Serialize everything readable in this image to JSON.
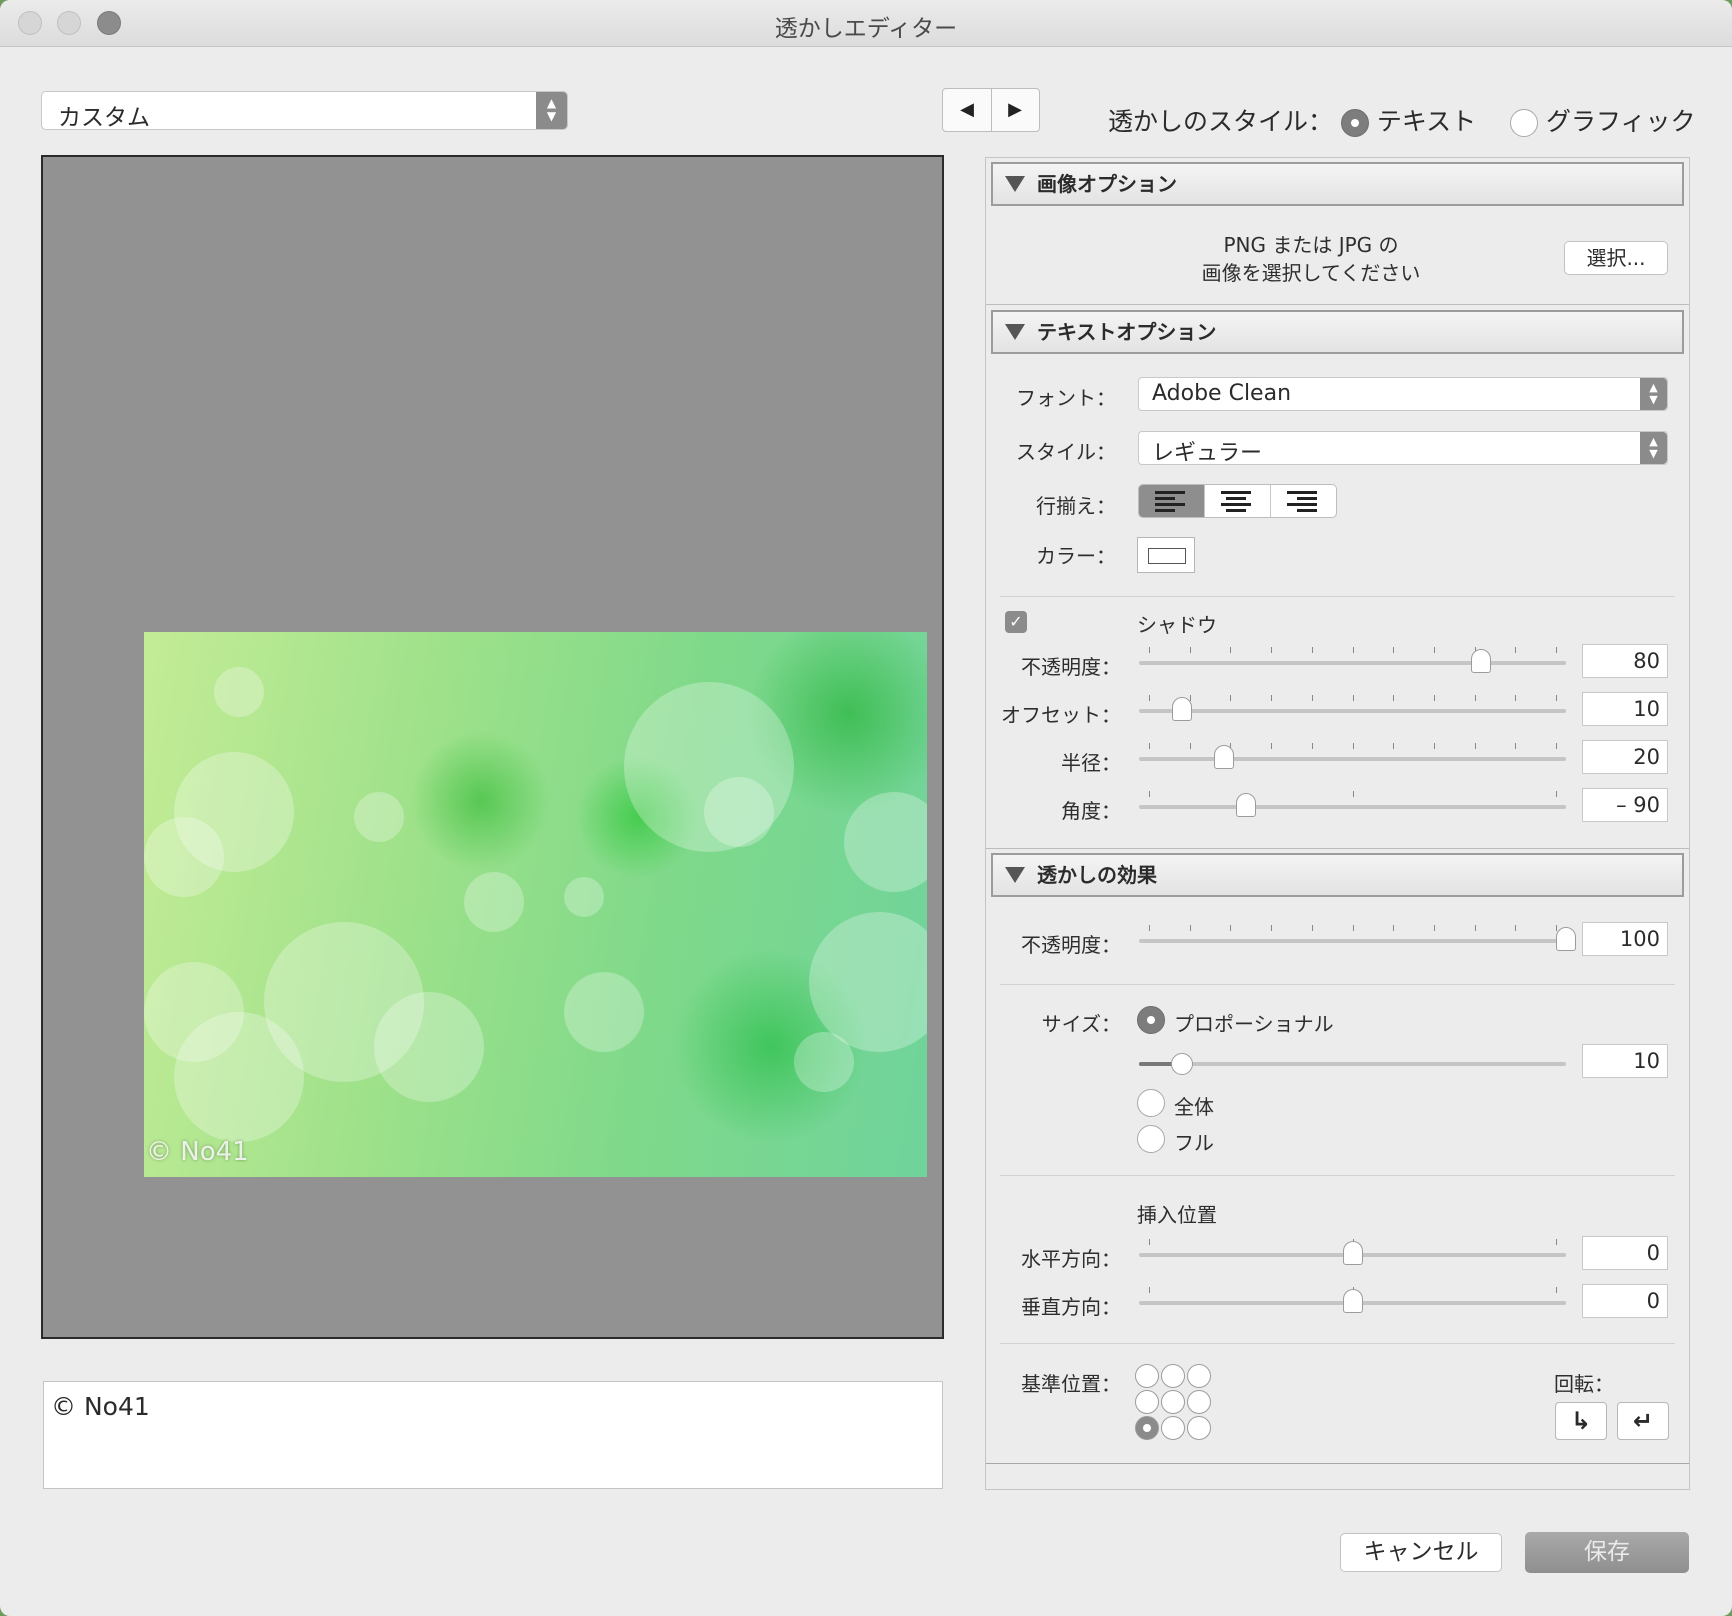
{
  "window": {
    "title": "透かしエディター"
  },
  "preset": {
    "value": "カスタム"
  },
  "nav": {
    "prev": "◀",
    "next": "▶"
  },
  "watermark_style": {
    "label": "透かしのスタイル：",
    "options": [
      {
        "label": "テキスト",
        "selected": true
      },
      {
        "label": "グラフィック",
        "selected": false
      }
    ]
  },
  "preview": {
    "watermark_text": "© No41"
  },
  "text_input": {
    "value": "© No41"
  },
  "image_options": {
    "header": "画像オプション",
    "prompt_line1": "PNG または JPG の",
    "prompt_line2": "画像を選択してください",
    "choose_button": "選択..."
  },
  "text_options": {
    "header": "テキストオプション",
    "font_label": "フォント：",
    "font_value": "Adobe Clean",
    "style_label": "スタイル：",
    "style_value": "レギュラー",
    "align_label": "行揃え：",
    "align_selected": "left",
    "color_label": "カラー：",
    "color_value": "#ffffff",
    "shadow": {
      "label": "シャドウ",
      "checked": true,
      "opacity_label": "不透明度：",
      "opacity": "80",
      "offset_label": "オフセット：",
      "offset": "10",
      "radius_label": "半径：",
      "radius": "20",
      "angle_label": "角度：",
      "angle": "– 90"
    }
  },
  "watermark_effects": {
    "header": "透かしの効果",
    "opacity_label": "不透明度：",
    "opacity": "100",
    "size_label": "サイズ：",
    "size_options": [
      {
        "label": "プロポーショナル",
        "selected": true
      },
      {
        "label": "全体",
        "selected": false
      },
      {
        "label": "フル",
        "selected": false
      }
    ],
    "size_value": "10",
    "inset_header": "挿入位置",
    "horizontal_label": "水平方向：",
    "horizontal": "0",
    "vertical_label": "垂直方向：",
    "vertical": "0",
    "anchor_label": "基準位置：",
    "anchor_selected": "bottom-left",
    "rotate_label": "回転：",
    "rotate_icons": [
      "rotate-right-icon",
      "rotate-left-icon"
    ]
  },
  "buttons": {
    "cancel": "キャンセル",
    "save": "保存"
  },
  "colors": {
    "window_bg": "#ececec",
    "preview_bg": "#929292",
    "selected_control": "#8b8b8b"
  }
}
